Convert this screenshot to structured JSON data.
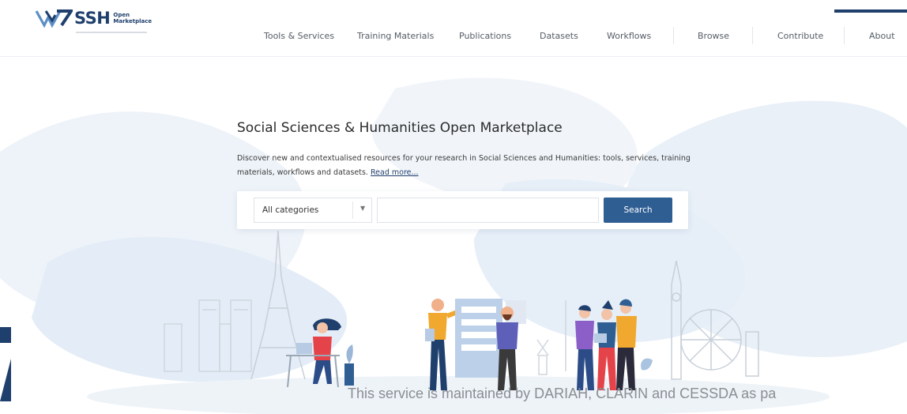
{
  "header": {
    "logo": {
      "brand": "SSH",
      "sub_line1": "Open",
      "sub_line2": "Marketplace"
    },
    "nav": [
      {
        "label": "Tools & Services"
      },
      {
        "label": "Training Materials"
      },
      {
        "label": "Publications"
      },
      {
        "label": "Datasets"
      },
      {
        "label": "Workflows"
      },
      {
        "label": "Browse"
      },
      {
        "label": "Contribute"
      },
      {
        "label": "About"
      }
    ]
  },
  "hero": {
    "title": "Social Sciences & Humanities Open Marketplace",
    "description": "Discover new and contextualised resources for your research in Social Sciences and Humanities: tools, services, training materials, workflows and datasets.",
    "read_more": "Read more..."
  },
  "search": {
    "category_selected": "All categories",
    "query_value": "",
    "query_placeholder": "",
    "button_label": "Search"
  },
  "footer": {
    "text": "This service is maintained by DARIAH, CLARIN and CESSDA as pa"
  },
  "colors": {
    "brand": "#1f3f6d",
    "button": "#2f5e93",
    "background_accent": "#e7eef7"
  }
}
